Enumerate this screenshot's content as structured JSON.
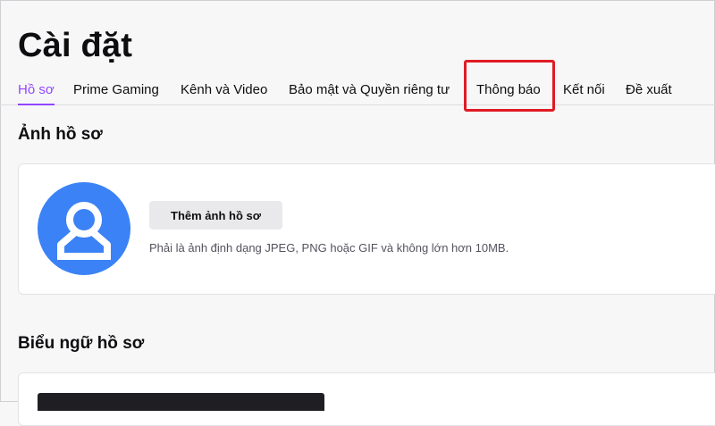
{
  "header": {
    "title": "Cài đặt"
  },
  "tabs": [
    {
      "label": "Hồ sơ",
      "active": true
    },
    {
      "label": "Prime Gaming"
    },
    {
      "label": "Kênh và Video"
    },
    {
      "label": "Bảo mật và Quyền riêng tư"
    },
    {
      "label": "Thông báo",
      "highlighted": true
    },
    {
      "label": "Kết nối"
    },
    {
      "label": "Đề xuất"
    }
  ],
  "profile_photo": {
    "heading": "Ảnh hồ sơ",
    "button_label": "Thêm ảnh hồ sơ",
    "hint": "Phải là ảnh định dạng JPEG, PNG hoặc GIF và không lớn hơn 10MB.",
    "avatar_icon": "user-avatar-icon"
  },
  "profile_banner": {
    "heading": "Biểu ngữ hồ sơ"
  },
  "colors": {
    "accent": "#9147ff",
    "avatar_bg": "#3b82f6",
    "highlight_box": "#e01b24"
  }
}
